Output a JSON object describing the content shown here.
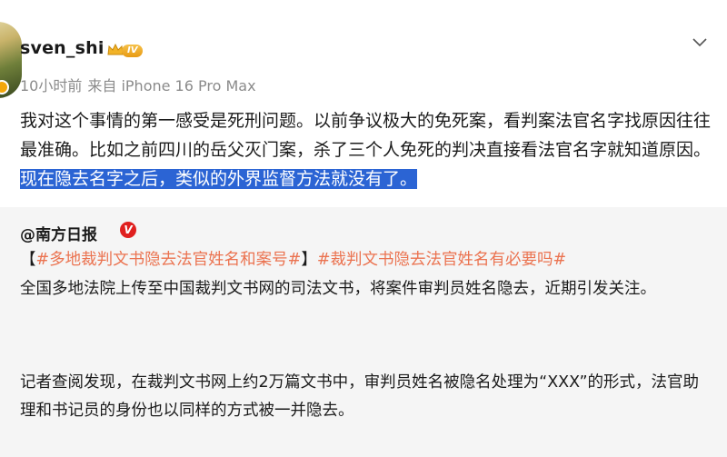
{
  "post": {
    "username": "sven_shi",
    "level_badge": "IV",
    "time": "10小时前",
    "source": "来自 iPhone 16 Pro Max",
    "text_plain": "我对这个事情的第一感受是死刑问题。以前争议极大的免死案，看判案法官名字找原因往往最准确。比如之前四川的岳父灭门案，杀了三个人免死的判决直接看法官名字就知道原因。",
    "text_highlighted": "现在隐去名字之后，类似的外界监督方法就没有了。"
  },
  "quoted": {
    "author": "@南方日报",
    "verified_mark": "V",
    "bracket_open": "【",
    "tag1": "#多地裁判文书隐去法官姓名和案号#",
    "bracket_close": "】",
    "tag2": "#裁判文书隐去法官姓名有必要吗#",
    "para1": "全国多地法院上传至中国裁判文书网的司法文书，将案件审判员姓名隐去，近期引发关注。",
    "para2": "记者查阅发现，在裁判文书网上约2万篇文书中，审判员姓名被隐名处理为“XXX”的形式，法官助理和书记员的身份也以同样的方式被一并隐去。"
  },
  "icons": {
    "avatar": "avatar-image",
    "crown": "crown-icon",
    "menu": "chevron-down-icon",
    "verified": "verified-icon"
  },
  "colors": {
    "highlight": "#2b64d4",
    "hashtag": "#eb7350",
    "quote_bg": "#f5f5f5",
    "meta_text": "#8b8b8b"
  }
}
